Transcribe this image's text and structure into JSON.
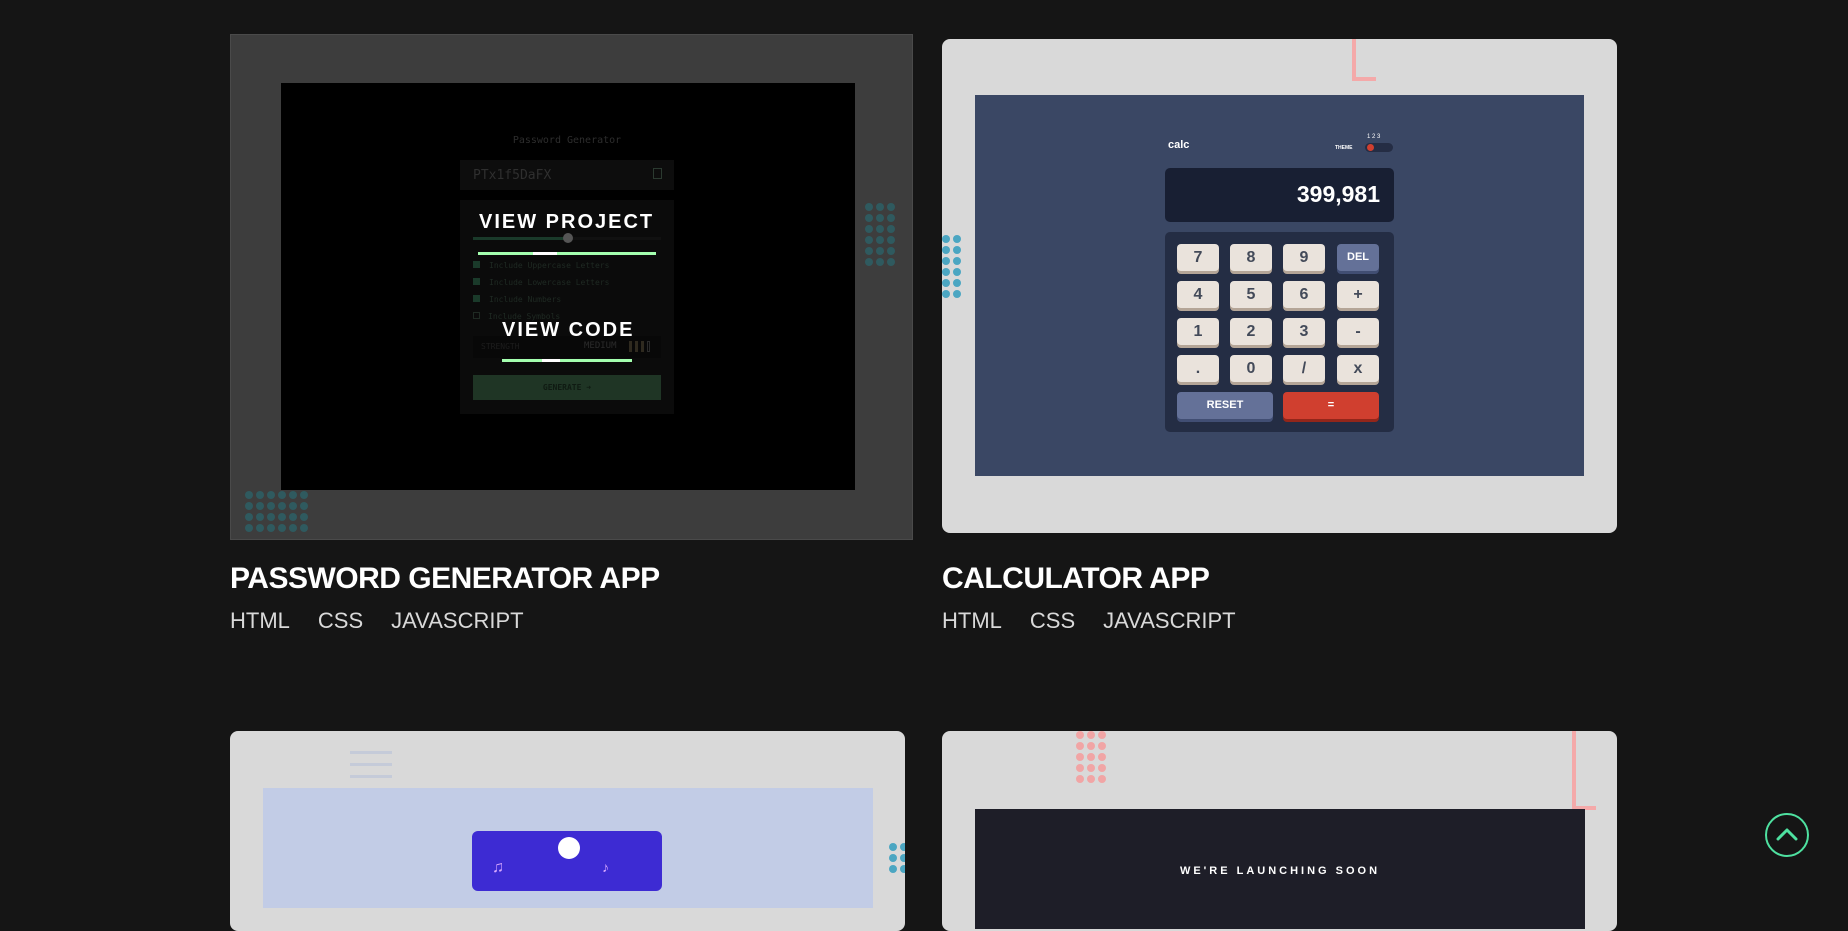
{
  "projects": [
    {
      "title": "PASSWORD GENERATOR APP",
      "tags": [
        "HTML",
        "CSS",
        "JAVASCRIPT"
      ],
      "view_project": "VIEW PROJECT",
      "view_code": "VIEW CODE",
      "preview": {
        "app_title": "Password Generator",
        "password": "PTx1f5DaFX",
        "options": [
          "Include Uppercase Letters",
          "Include Lowercase Letters",
          "Include Numbers",
          "Include Symbols"
        ],
        "strength_label": "STRENGTH",
        "strength_value": "MEDIUM",
        "generate_label": "GENERATE"
      }
    },
    {
      "title": "CALCULATOR APP",
      "tags": [
        "HTML",
        "CSS",
        "JAVASCRIPT"
      ],
      "preview": {
        "logo": "calc",
        "theme_label": "THEME",
        "theme_numbers": "1 2 3",
        "display": "399,981",
        "keys": [
          "7",
          "8",
          "9",
          "DEL",
          "4",
          "5",
          "6",
          "+",
          "1",
          "2",
          "3",
          "-",
          ".",
          "0",
          "/",
          "x"
        ],
        "reset": "RESET",
        "equals": "="
      }
    },
    {
      "preview": {}
    },
    {
      "preview": {
        "headline": "WE'RE LAUNCHING SOON"
      }
    }
  ],
  "colors": {
    "page_bg": "#151515",
    "accent_green": "#4ee1a0",
    "calc_bg": "#3a4764",
    "countdown_bg": "#1e1e28",
    "ilustration_bg": "#c2cce6"
  },
  "icons": {
    "scroll_top": "chevron-up-circle-icon"
  }
}
